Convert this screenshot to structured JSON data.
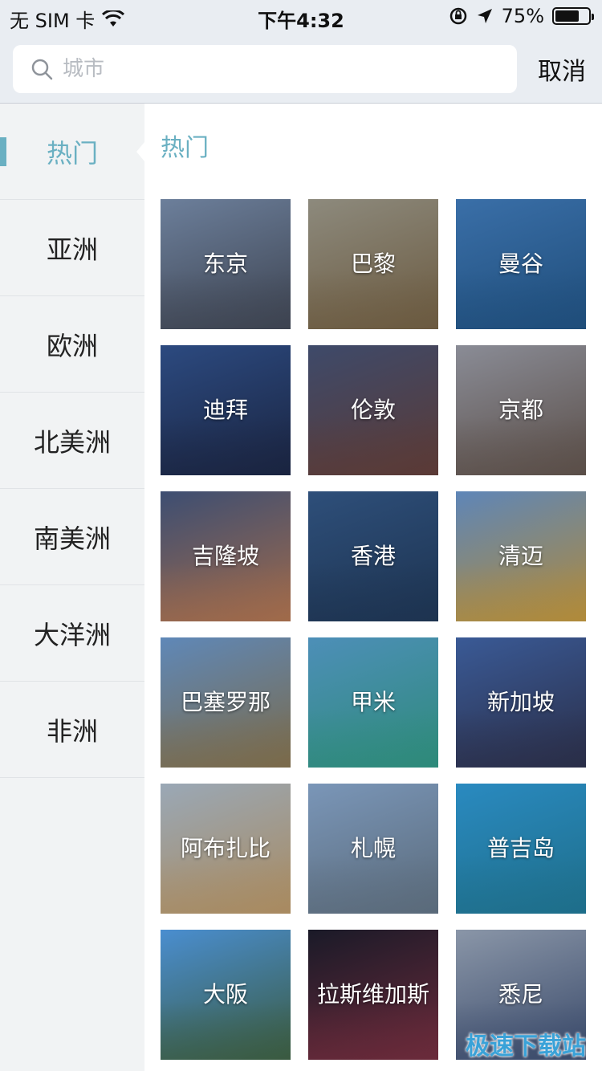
{
  "status_bar": {
    "carrier": "无 SIM 卡",
    "time": "下午4:32",
    "battery_percent": "75%",
    "battery_level": 0.75
  },
  "search": {
    "placeholder": "城市",
    "value": "",
    "cancel_label": "取消"
  },
  "sidebar": {
    "items": [
      {
        "label": "热门",
        "active": true
      },
      {
        "label": "亚洲",
        "active": false
      },
      {
        "label": "欧洲",
        "active": false
      },
      {
        "label": "北美洲",
        "active": false
      },
      {
        "label": "南美洲",
        "active": false
      },
      {
        "label": "大洋洲",
        "active": false
      },
      {
        "label": "非洲",
        "active": false
      }
    ]
  },
  "main": {
    "section_title": "热门",
    "cities": [
      {
        "name": "东京",
        "colors": [
          "#6c7f9b",
          "#3d4350"
        ]
      },
      {
        "name": "巴黎",
        "colors": [
          "#8d8a7d",
          "#6b5a40"
        ]
      },
      {
        "name": "曼谷",
        "colors": [
          "#3a6fa8",
          "#1f4d7a"
        ]
      },
      {
        "name": "迪拜",
        "colors": [
          "#2c4a80",
          "#1a2440"
        ]
      },
      {
        "name": "伦敦",
        "colors": [
          "#3e4a6a",
          "#5a3a36"
        ]
      },
      {
        "name": "京都",
        "colors": [
          "#8a8c96",
          "#5a4e48"
        ]
      },
      {
        "name": "吉隆坡",
        "colors": [
          "#3d4e72",
          "#a06a4a"
        ]
      },
      {
        "name": "香港",
        "colors": [
          "#2e4f7a",
          "#1d3350"
        ]
      },
      {
        "name": "清迈",
        "colors": [
          "#5e86b8",
          "#b08a3a"
        ]
      },
      {
        "name": "巴塞罗那",
        "colors": [
          "#5f88b8",
          "#7a6a4a"
        ]
      },
      {
        "name": "甲米",
        "colors": [
          "#4d8fb8",
          "#2e8a7a"
        ]
      },
      {
        "name": "新加坡",
        "colors": [
          "#3a5a96",
          "#2a2e48"
        ]
      },
      {
        "name": "阿布扎比",
        "colors": [
          "#9aa8b6",
          "#a88a60"
        ]
      },
      {
        "name": "札幌",
        "colors": [
          "#7a96b8",
          "#5a6a7a"
        ]
      },
      {
        "name": "普吉岛",
        "colors": [
          "#2a8ac0",
          "#1e6e8a"
        ]
      },
      {
        "name": "大阪",
        "colors": [
          "#4a8ed0",
          "#3a5a40"
        ]
      },
      {
        "name": "拉斯维加斯",
        "colors": [
          "#1a1a28",
          "#6a2a3a"
        ]
      },
      {
        "name": "悉尼",
        "colors": [
          "#8a96a8",
          "#3a4a6a"
        ]
      }
    ]
  },
  "watermark": "极速下载站"
}
